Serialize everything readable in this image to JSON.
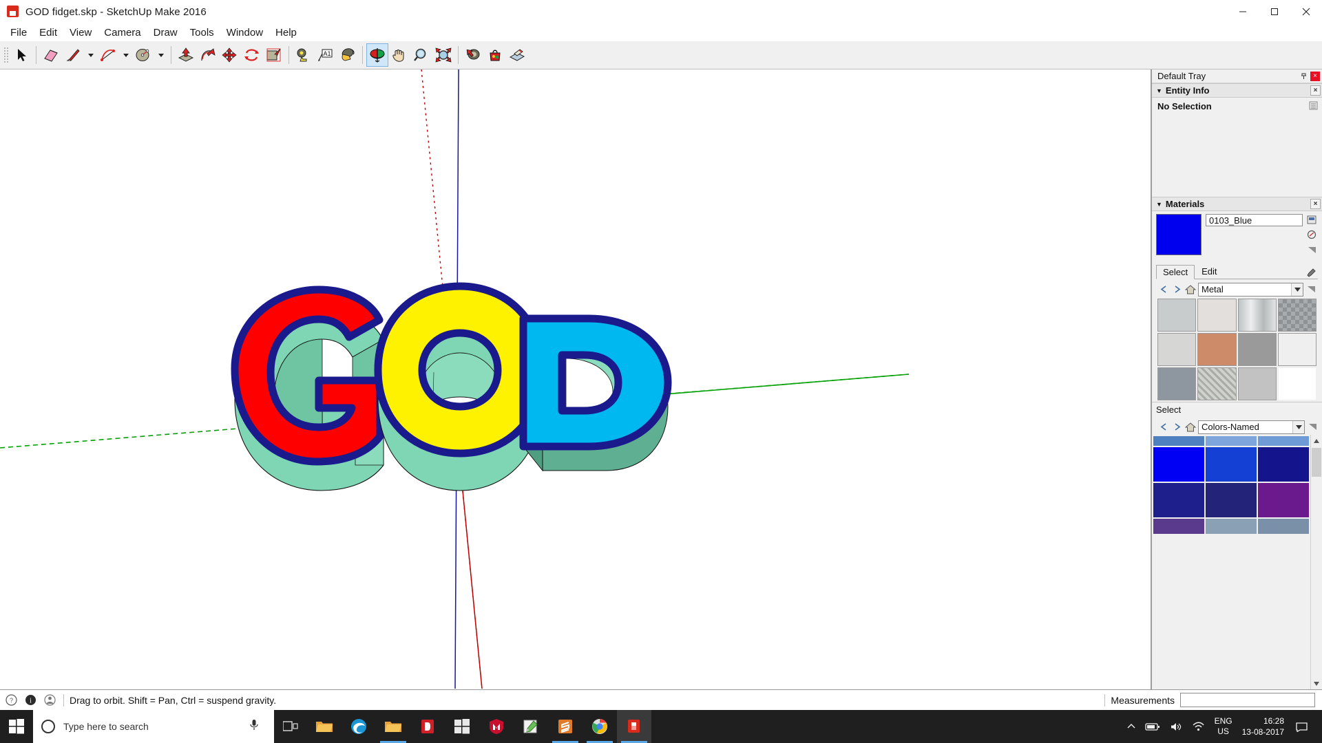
{
  "window": {
    "title": "GOD fidget.skp - SketchUp Make 2016",
    "app_icon": "sketchup-icon",
    "minimize": "minimize-button",
    "maximize": "maximize-button",
    "close": "close-button"
  },
  "menubar": {
    "items": [
      "File",
      "Edit",
      "View",
      "Camera",
      "Draw",
      "Tools",
      "Window",
      "Help"
    ]
  },
  "toolbar": {
    "groups": [
      {
        "tools": [
          {
            "name": "select-tool",
            "icon": "arrow-cursor-icon",
            "active": false
          }
        ]
      },
      {
        "tools": [
          {
            "name": "eraser-tool",
            "icon": "eraser-icon",
            "active": false
          },
          {
            "name": "line-tool",
            "icon": "pencil-icon",
            "active": false,
            "dropdown": true
          },
          {
            "name": "arc-tool",
            "icon": "arc-icon",
            "active": false,
            "dropdown": true
          },
          {
            "name": "shapes-tool",
            "icon": "circle-icon",
            "active": false,
            "dropdown": true
          }
        ]
      },
      {
        "tools": [
          {
            "name": "pushpull-tool",
            "icon": "push-pull-icon",
            "active": false
          },
          {
            "name": "followme-tool",
            "icon": "follow-me-icon",
            "active": false
          },
          {
            "name": "move-tool",
            "icon": "move-arrows-icon",
            "active": false
          },
          {
            "name": "rotate-tool",
            "icon": "rotate-icon",
            "active": false
          },
          {
            "name": "scale-tool",
            "icon": "scale-icon",
            "active": false
          }
        ]
      },
      {
        "tools": [
          {
            "name": "tape-measure-tool",
            "icon": "tape-measure-icon",
            "active": false
          },
          {
            "name": "text-tool",
            "icon": "text-label-icon",
            "active": false
          },
          {
            "name": "paint-bucket-tool",
            "icon": "paint-bucket-icon",
            "active": false
          }
        ]
      },
      {
        "tools": [
          {
            "name": "orbit-tool",
            "icon": "orbit-icon",
            "active": true
          },
          {
            "name": "pan-tool",
            "icon": "hand-icon",
            "active": false
          },
          {
            "name": "zoom-tool",
            "icon": "magnifier-icon",
            "active": false
          },
          {
            "name": "zoom-extents-tool",
            "icon": "zoom-extents-icon",
            "active": false
          }
        ]
      },
      {
        "tools": [
          {
            "name": "previous-view-tool",
            "icon": "previous-view-icon",
            "active": false
          },
          {
            "name": "3d-warehouse-tool",
            "icon": "warehouse-icon",
            "active": false
          },
          {
            "name": "share-model-tool",
            "icon": "share-model-icon",
            "active": false
          }
        ]
      }
    ]
  },
  "viewport": {
    "model_name": "GOD",
    "letters": [
      {
        "char": "G",
        "face_color": "#FF0000",
        "outline_color": "#1A1A8C",
        "side_color": "#7FD6B4"
      },
      {
        "char": "O",
        "face_color": "#FFF200",
        "outline_color": "#1A1A8C",
        "side_color": "#7FD6B4"
      },
      {
        "char": "D",
        "face_color": "#00B8F0",
        "outline_color": "#1A1A8C",
        "side_color": "#7FD6B4"
      }
    ],
    "axes": [
      {
        "name": "green-axis",
        "color": "#00A000"
      },
      {
        "name": "red-axis",
        "color": "#C00000"
      },
      {
        "name": "blue-axis",
        "color": "#1414A0"
      }
    ],
    "background": "#FFFFFF"
  },
  "tray": {
    "title": "Default Tray",
    "pin_icon": "pin-icon",
    "close_icon": "close-icon",
    "entity_info": {
      "title": "Entity Info",
      "collapse_icon": "triangle-down-icon",
      "close_label": "×",
      "selection_text": "No Selection",
      "expand_icon": "expand-details-icon"
    },
    "materials": {
      "title": "Materials",
      "collapse_icon": "triangle-down-icon",
      "close_label": "×",
      "current_swatch_color": "#0000EE",
      "current_name": "0103_Blue",
      "create_icon": "create-material-icon",
      "sample_icon": "sample-paint-icon",
      "details_icon": "details-arrow-icon",
      "tabs": [
        {
          "label": "Select",
          "selected": true
        },
        {
          "label": "Edit",
          "selected": false
        }
      ],
      "eyedropper_icon": "eyedropper-icon",
      "nav": {
        "back_icon": "back-arrow-icon",
        "forward_icon": "forward-arrow-icon",
        "home_icon": "home-icon",
        "library": "Metal",
        "dropdown_icon": "chevron-down-icon",
        "details_icon": "details-arrow-icon"
      },
      "swatches": [
        "#C9CCCD",
        "#E3DFDC",
        "#BBBFC0",
        "#A8ACAE",
        "#D6D6D4",
        "#CE8B6A",
        "#9A9A9A",
        "#EFEFEF",
        "#8E97A0",
        "#C4C7C2",
        "#C2C2C2",
        "#FFFFFF"
      ]
    },
    "colors": {
      "section_label": "Select",
      "nav": {
        "back_icon": "back-arrow-icon",
        "forward_icon": "forward-arrow-icon",
        "home_icon": "home-icon",
        "library": "Colors-Named",
        "dropdown_icon": "chevron-down-icon",
        "details_icon": "details-arrow-icon"
      },
      "swatches": [
        "#4E7FBF",
        "#7EA6DD",
        "#6E9BD6",
        "#0000F5",
        "#1540D4",
        "#14148C",
        "#1E1E8C",
        "#23237A",
        "#6A1A8C",
        "#5A3A8C",
        "#8AA0B4",
        "#7A8FA8"
      ],
      "scrollbar": {
        "up_icon": "scroll-up-icon",
        "down_icon": "scroll-down-icon"
      }
    }
  },
  "statusbar": {
    "help_icon": "question-circle-icon",
    "info_icon": "info-circle-icon",
    "person_icon": "person-icon",
    "message": "Drag to orbit. Shift = Pan, Ctrl = suspend gravity.",
    "measurements_label": "Measurements",
    "measurements_value": ""
  },
  "taskbar": {
    "start_icon": "windows-logo-icon",
    "search_placeholder": "Type here to search",
    "search_icon": "search-circle-icon",
    "mic_icon": "microphone-icon",
    "taskview_icon": "task-view-icon",
    "apps": [
      {
        "name": "file-explorer-pinned",
        "icon": "folder-icon",
        "running": false,
        "active": false
      },
      {
        "name": "edge-browser",
        "icon": "edge-icon",
        "running": false,
        "active": false
      },
      {
        "name": "file-explorer",
        "icon": "folder-icon",
        "running": true,
        "active": false
      },
      {
        "name": "pdf-reader",
        "icon": "pdf-icon",
        "running": false,
        "active": false
      },
      {
        "name": "microsoft-store",
        "icon": "store-icon",
        "running": false,
        "active": false
      },
      {
        "name": "mcafee",
        "icon": "shield-icon",
        "running": false,
        "active": false
      },
      {
        "name": "notepad-app",
        "icon": "notepad-icon",
        "running": false,
        "active": false
      },
      {
        "name": "sublime-text",
        "icon": "sublime-icon",
        "running": true,
        "active": false
      },
      {
        "name": "chrome-browser",
        "icon": "chrome-icon",
        "running": true,
        "active": false
      },
      {
        "name": "sketchup-app",
        "icon": "sketchup-icon",
        "running": true,
        "active": true
      }
    ],
    "tray": {
      "show_hidden_icon": "chevron-up-icon",
      "battery_icon": "battery-icon",
      "volume_icon": "speaker-icon",
      "network_icon": "wifi-icon",
      "language_line1": "ENG",
      "language_line2": "US",
      "time": "16:28",
      "date": "13-08-2017",
      "action_center_icon": "notification-icon"
    }
  }
}
